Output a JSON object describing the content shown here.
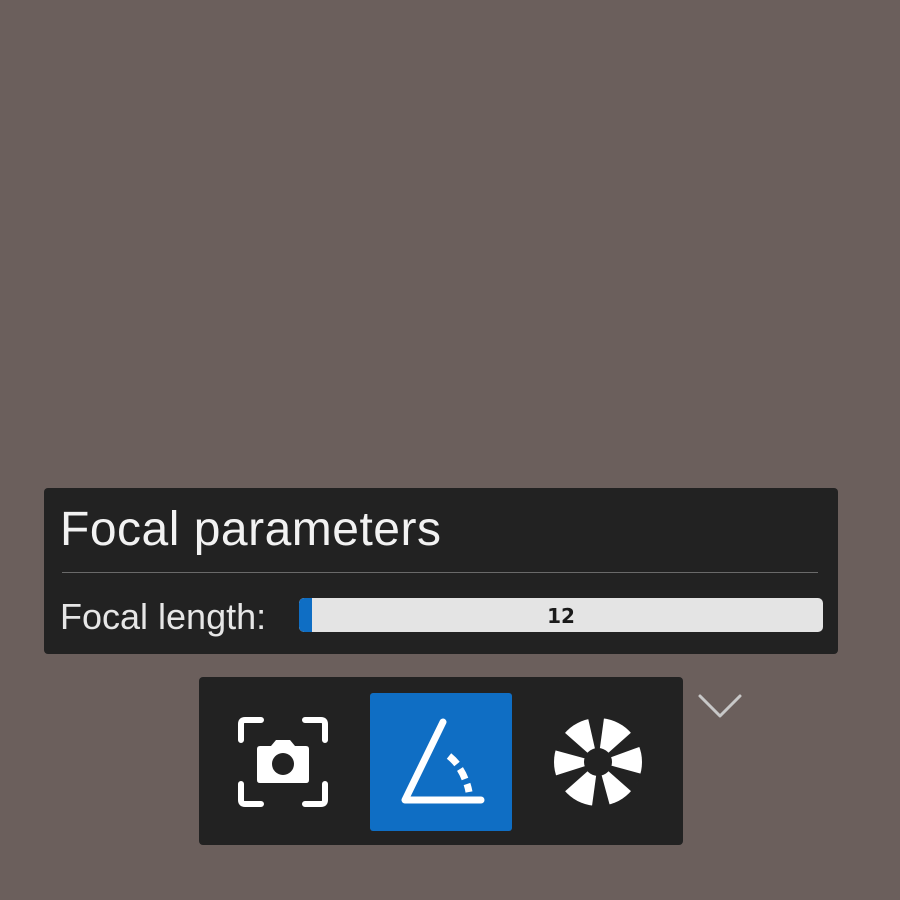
{
  "panel": {
    "title": "Focal parameters",
    "focal_length": {
      "label": "Focal length:",
      "value": "12",
      "fill_fraction": 0.025
    }
  },
  "toolbar": {
    "buttons": [
      {
        "icon": "camera-focus-icon",
        "active": false
      },
      {
        "icon": "angle-icon",
        "active": true
      },
      {
        "icon": "aperture-icon",
        "active": false
      }
    ],
    "expand_icon": "chevron-down-icon"
  },
  "colors": {
    "background": "#6b5f5c",
    "panel": "#222222",
    "accent": "#0f6ec4",
    "slider_track": "#e4e4e4"
  }
}
